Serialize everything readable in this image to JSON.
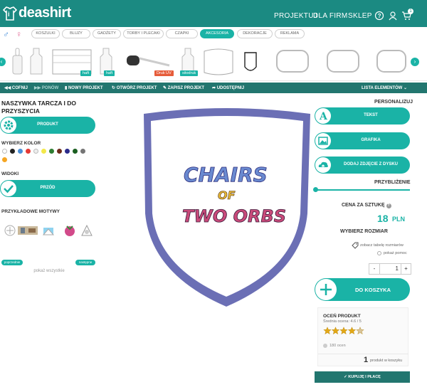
{
  "brand": {
    "name": "deashirt",
    "initial": "i",
    "accent": "#1ab3a6",
    "dark": "#22766f",
    "bar": "#1b8a82"
  },
  "nav": {
    "projektuj": "PROJEKTUJ",
    "dla_firm": "DLA FIRM",
    "sklep": "SKLEP",
    "cart_count": "1"
  },
  "categories": [
    "KOSZULKI",
    "BLUZY",
    "GADŻETY",
    "TORBY I PLECAKI",
    "CZAPKI",
    "AKCESORIA",
    "DEKORACJE",
    "REKLAMA"
  ],
  "active_category": "AKCESORIA",
  "gender": {
    "male": "♂",
    "female": "♀"
  },
  "product_tags": {
    "haft1": "haft",
    "haft2": "haft",
    "druk_uv": "Druk UV",
    "sitodruk": "sitodruk"
  },
  "toolbar": {
    "undo": "COFNIJ",
    "redo": "PONÓW",
    "new_project": "NOWY PROJEKT",
    "open_project": "OTWÓRZ PROJEKT",
    "save_project": "ZAPISZ PROJEKT",
    "share": "UDOSTĘPNIJ",
    "element_list": "LISTA ELEMENTÓW"
  },
  "left": {
    "product_title_1": "NASZYWKA TARCZA I DO",
    "product_title_2": "PRZYSZYCIA",
    "product_btn": "PRODUKT",
    "color_head": "WYBIERZ KOLOR",
    "colors": [
      "#ffffff",
      "#222222",
      "#4a90d9",
      "#e53935",
      "#eeeeee",
      "#f3e84a",
      "#2e7d32",
      "#6d2a1a",
      "#2b2b8a",
      "#1b5e20",
      "#757575",
      "#f5a623"
    ],
    "views_head": "WIDOKI",
    "view_btn": "PRZÓD",
    "motifs_head": "PRZYKŁADOWE MOTYWY",
    "prev": "poprzednie",
    "next": "następne",
    "show_all": "pokaż wszystkie"
  },
  "artwork": {
    "lines": [
      "CHAIRS",
      "OF",
      "TWO ORBS"
    ],
    "shield_color": "#6b6fb5"
  },
  "right": {
    "personalize": "PERSONALIZUJ",
    "text_btn": "TEKST",
    "graphic_btn": "GRAFIKA",
    "upload_btn": "DODAJ ZDJĘCIE Z DYSKU",
    "zoom": "PRZYBLIŻENIE",
    "price_label": "CENA ZA SZTUKĘ",
    "price": "18",
    "currency": "PLN",
    "size_head": "WYBIERZ ROZMIAR",
    "size_table": "zobacz tabelę rozmiarów",
    "help": "pokaż pomoc",
    "qty_minus": "-",
    "qty": "1",
    "qty_plus": "+",
    "add_to_cart": "DO KOSZYKA",
    "rate_head": "OCEŃ PRODUKT",
    "avg_rating": "Średnia ocena: 4.6 / 5",
    "rating_value": 4.6,
    "ratings_count": "180 ocen",
    "in_cart_num": "1",
    "in_cart_text": "produkt w koszyku",
    "buy": "KUPUJĘ I PŁACĘ"
  }
}
